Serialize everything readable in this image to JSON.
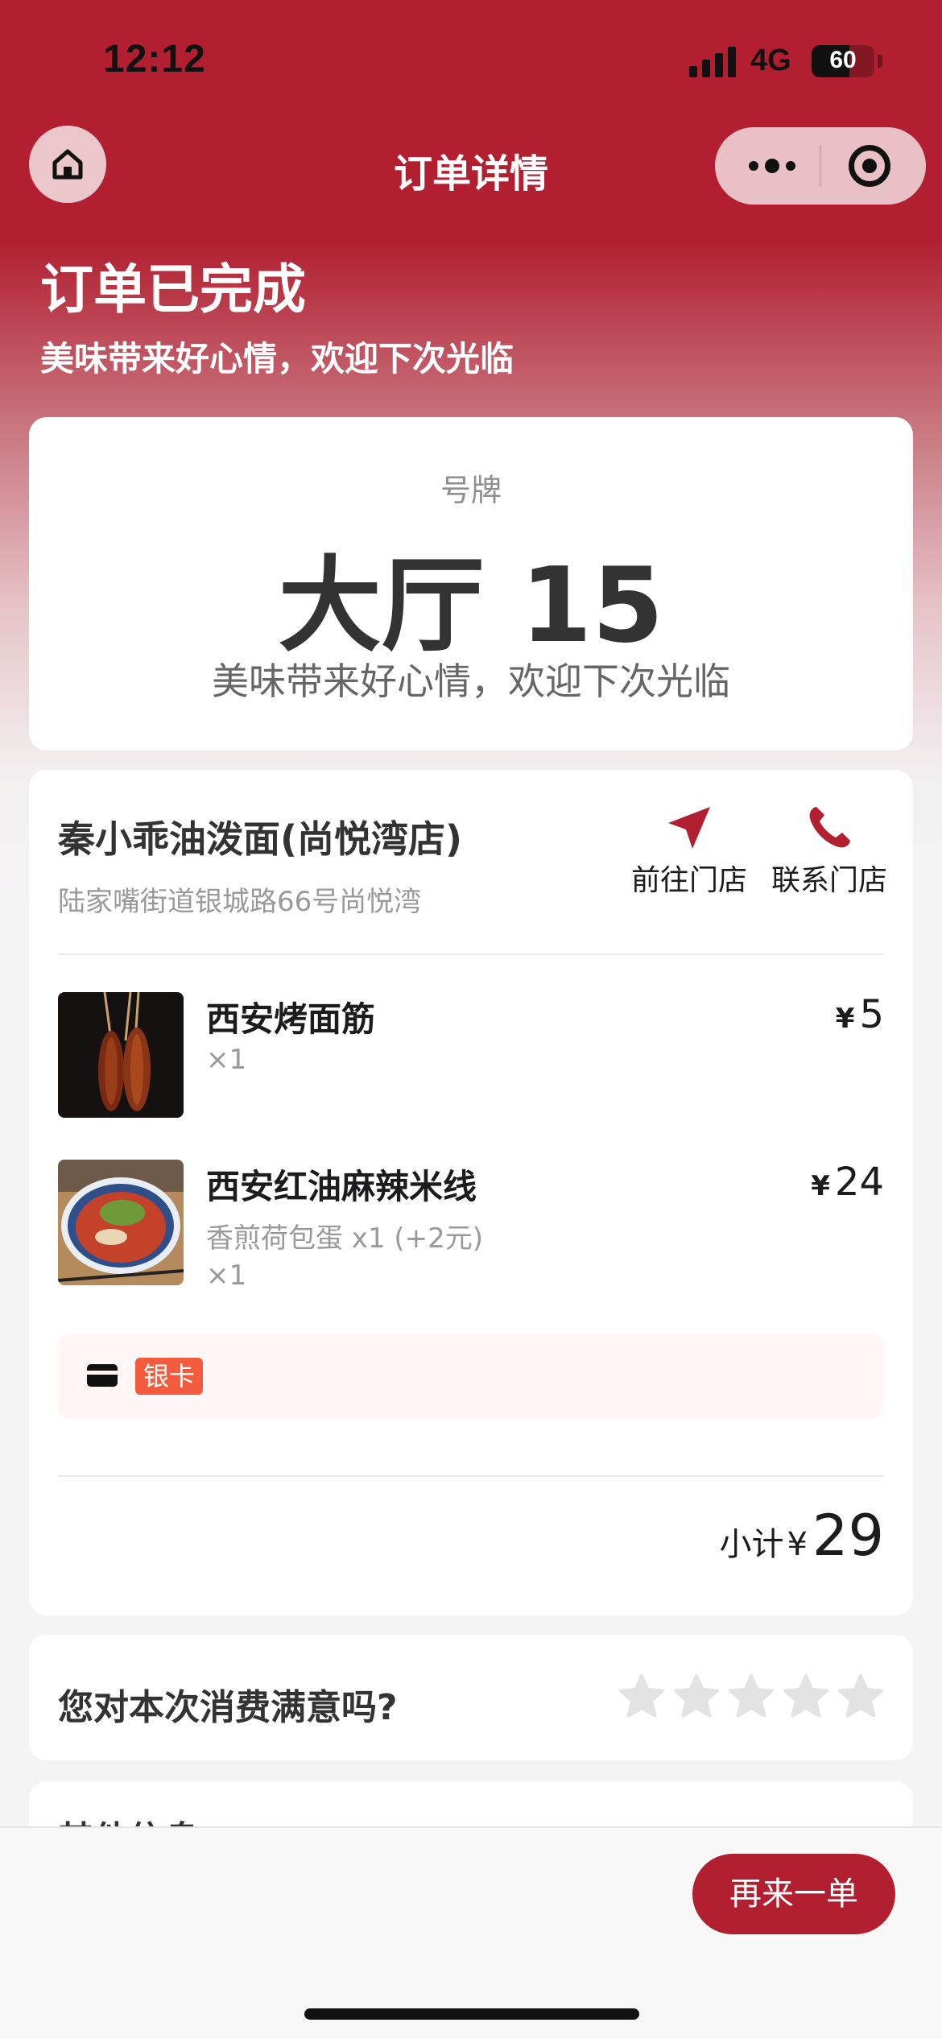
{
  "status_bar": {
    "time": "12:12",
    "network": "4G",
    "battery": "60",
    "battery_level": 0.6
  },
  "nav": {
    "title": "订单详情"
  },
  "header": {
    "status_title": "订单已完成",
    "status_subtitle": "美味带来好心情，欢迎下次光临"
  },
  "ticket": {
    "label": "号牌",
    "value": "大厅 15",
    "message": "美味带来好心情，欢迎下次光临"
  },
  "store": {
    "name": "秦小乖油泼面(尚悦湾店)",
    "address": "陆家嘴街道银城路66号尚悦湾",
    "navigate_label": "前往门店",
    "call_label": "联系门店"
  },
  "items": [
    {
      "name": "西安烤面筋",
      "qty": "×1",
      "currency": "¥",
      "price": "5"
    },
    {
      "name": "西安红油麻辣米线",
      "spec": "香煎荷包蛋 x1 (+2元)",
      "qty": "×1",
      "currency": "¥",
      "price": "24"
    }
  ],
  "payment": {
    "tag": "银卡"
  },
  "subtotal": {
    "label": "小计",
    "currency": "¥",
    "amount": "29"
  },
  "rating": {
    "question": "您对本次消费满意吗?",
    "max_stars": 5,
    "selected": 0
  },
  "other": {
    "title": "其他信息"
  },
  "bottom": {
    "reorder_label": "再来一单"
  },
  "colors": {
    "brand": "#b11f30",
    "tag": "#f25b3c",
    "star_inactive": "#e3e3e3"
  }
}
